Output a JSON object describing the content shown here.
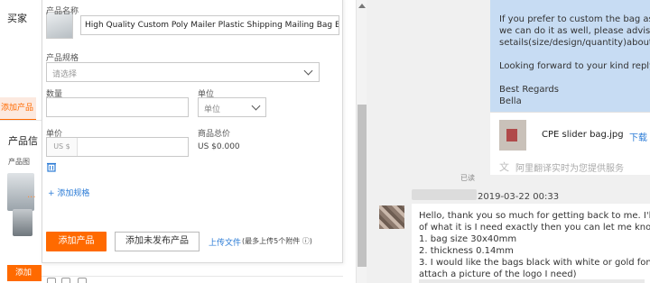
{
  "background": {
    "title": "买家",
    "tab_label": "添加产品",
    "section_label": "产品信",
    "image_label": "产品图",
    "add_button": "添加"
  },
  "form": {
    "name_label": "产品名称",
    "name_value": "High Quality Custom Poly Mailer Plastic Shipping Mailing Bag Envelopes",
    "spec_label": "产品规格",
    "spec_placeholder": "请选择",
    "qty_label": "数量",
    "unit_label": "单位",
    "unit_placeholder": "单位",
    "price_label": "单价",
    "price_prefix": "US $",
    "total_label": "商品总价",
    "total_value": "US $0.000",
    "add_spec": "+ 添加规格",
    "add_product_button": "添加产品",
    "add_unpublished_button": "添加未发布产品",
    "upload_link": "上传文件",
    "upload_note": "(最多上传5个附件 ⓘ)",
    "accent_color": "#ff6a00",
    "link_color": "#2b7bd6"
  },
  "chat": {
    "own_message_lines": [
      "If you prefer to custom the bag as pe",
      "we can do it as well, please advise m",
      "setails(size/design/quantity)about it.",
      "",
      "Looking forward to your kind reply!",
      "",
      "Best Regards",
      "Bella"
    ],
    "file_name": "CPE slider bag.jpg",
    "file_download": "下载",
    "translate_text": "阿里翻译实时为您提供服务",
    "read_status": "已读",
    "timestamp": "2019-03-22 00:33",
    "incoming_lines": [
      "Hello, thank you so much for getting back to me. I'll mak",
      "of what it is I need exactly then you can let me know the",
      "1. bag size 30x40mm",
      "2. thickness 0.14mm",
      "3. I would like the bags black with white or gold font colo",
      "attach a picture of the logo I need)"
    ],
    "own_bubble_color": "#c7dcf3"
  }
}
